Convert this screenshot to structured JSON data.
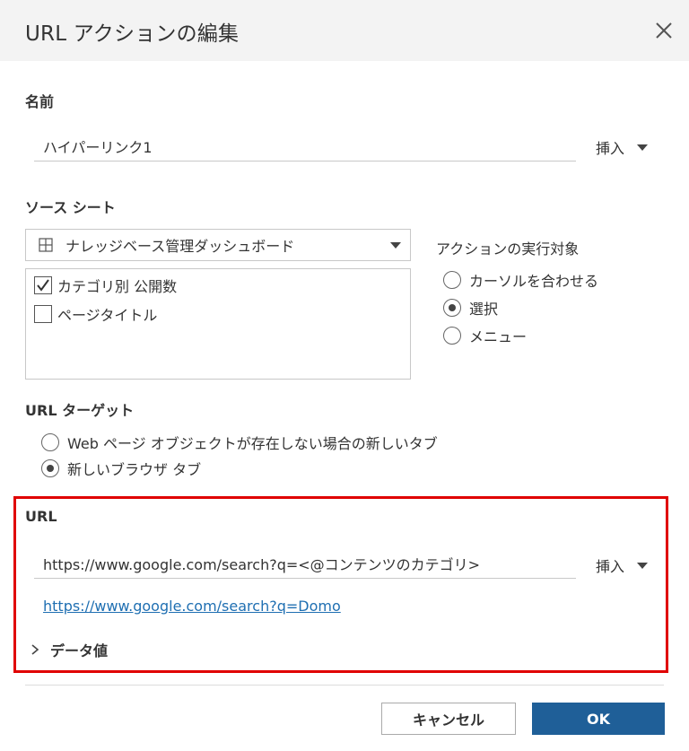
{
  "dialog": {
    "title": "URL アクションの編集"
  },
  "name_section": {
    "label": "名前",
    "value": "ハイパーリンク1",
    "insert_label": "挿入"
  },
  "source_sheet": {
    "label": "ソース シート",
    "selected": "ナレッジベース管理ダッシュボード",
    "sheets": [
      {
        "label": "カテゴリ別 公開数",
        "checked": true
      },
      {
        "label": "ページタイトル",
        "checked": false
      }
    ]
  },
  "run_action_on": {
    "label": "アクションの実行対象",
    "options": [
      {
        "label": "カーソルを合わせる",
        "checked": false
      },
      {
        "label": "選択",
        "checked": true
      },
      {
        "label": "メニュー",
        "checked": false
      }
    ]
  },
  "url_target": {
    "label": "URL ターゲット",
    "options": [
      {
        "label": "Web ページ オブジェクトが存在しない場合の新しいタブ",
        "checked": false
      },
      {
        "label": "新しいブラウザ タブ",
        "checked": true
      }
    ]
  },
  "url_section": {
    "label": "URL",
    "value": "https://www.google.com/search?q=<@コンテンツのカテゴリ>",
    "insert_label": "挿入",
    "preview_link": "https://www.google.com/search?q=Domo",
    "data_values_label": "データ値",
    "highlight_color": "#e00000"
  },
  "footer": {
    "cancel_label": "キャンセル",
    "ok_label": "OK",
    "ok_color": "#1f5f98"
  },
  "icons": [
    "close-icon",
    "grid-icon",
    "dropdown-arrow-icon",
    "chevron-right-icon",
    "checkmark-icon"
  ]
}
